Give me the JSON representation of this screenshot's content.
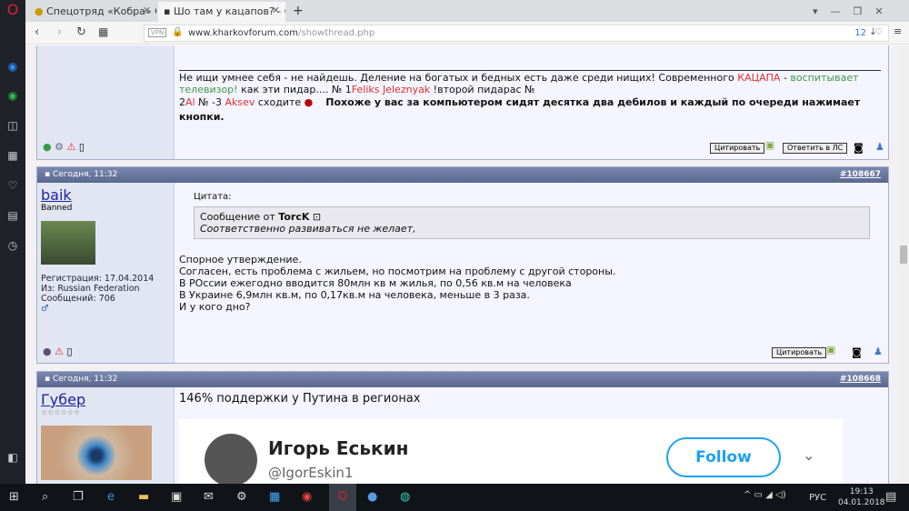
{
  "browser": {
    "tabs": [
      {
        "title": "Спецотряд «Кобра» Сезо"
      },
      {
        "title": "Шо там у кацапов? - Стр"
      }
    ],
    "new_tab": "+",
    "url_domain": "www.kharkovforum.com",
    "url_path": "/showthread.php",
    "vpn": "VPN",
    "badge": "12"
  },
  "post0": {
    "line1a": "Не ищи умнее себя - не найдешь. Деление на богатых и бедных есть даже среди нищих! Современного ",
    "kacapa": "КАЦАПА",
    "dash": " - ",
    "vospit": "воспитывает",
    "tv": "телевизор!",
    "line2": " как эти пидар.... № 1",
    "feliks": "Feliks Jeleznyak",
    "line2b": " !второй пидарас №",
    "n2": "2",
    "al": "Al",
    "n3": " № -3 ",
    "aksev": "Aksev",
    "shodite": " сходите",
    "bold": "Похоже у вас за компьютером сидят десятка два дебилов и каждый по очереди нажимает кнопки.",
    "quote_btn": "Цитировать",
    "pm_btn": "Ответить в ЛС"
  },
  "post1": {
    "date": "Сегодня, 11:32",
    "number": "#108667",
    "user": "baik",
    "title": "Banned",
    "reg": "Регистрация: 17.04.2014",
    "from": "Из: Russian Federation",
    "posts": "Сообщений: 706",
    "quote_label": "Цитата:",
    "quote_from": "Сообщение от ",
    "quote_author": "TorcK",
    "quote_text": "Соответственно развиваться не желает,",
    "lines": [
      "Спорное утверждение.",
      "Согласен, есть проблема с жильем, но посмотрим на проблему с другой стороны.",
      "В РОссии ежегодно вводится 80млн кв м жилья, по 0,56 кв.м на человека",
      "В Украине 6,9млн кв.м, по 0,17кв.м на человека, меньше в 3 раза.",
      "И у кого дно?"
    ],
    "quote_btn": "Цитировать"
  },
  "post2": {
    "date": "Сегодня, 11:32",
    "number": "#108668",
    "user": "Губер",
    "stars": "☆☆☆☆☆☆",
    "text": "146% поддержки у Путина в регионах",
    "tweet_name": "Игорь Еськин",
    "tweet_handle": "@IgorEskin1",
    "follow": "Follow"
  },
  "taskbar": {
    "lang": "РУС",
    "time": "19:13",
    "date": "04.01.2018"
  }
}
